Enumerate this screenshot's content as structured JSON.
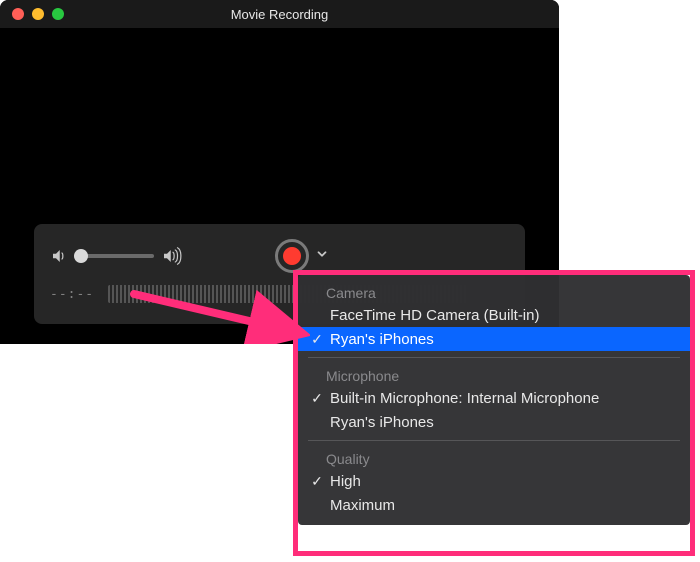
{
  "window": {
    "title": "Movie Recording"
  },
  "controls": {
    "timecode": "--:--"
  },
  "menu": {
    "camera": {
      "heading": "Camera",
      "options": [
        {
          "label": "FaceTime HD Camera (Built-in)",
          "checked": false,
          "selected": false
        },
        {
          "label": "Ryan's iPhones",
          "checked": true,
          "selected": true
        }
      ]
    },
    "microphone": {
      "heading": "Microphone",
      "options": [
        {
          "label": "Built-in Microphone: Internal Microphone",
          "checked": true,
          "selected": false
        },
        {
          "label": "Ryan's iPhones",
          "checked": false,
          "selected": false
        }
      ]
    },
    "quality": {
      "heading": "Quality",
      "options": [
        {
          "label": "High",
          "checked": true,
          "selected": false
        },
        {
          "label": "Maximum",
          "checked": false,
          "selected": false
        }
      ]
    }
  },
  "colors": {
    "annotation": "#ff2d7a",
    "record": "#ff3b30",
    "selected_bg": "#0a66ff"
  }
}
